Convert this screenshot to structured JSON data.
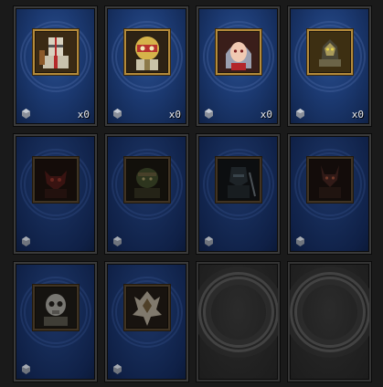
{
  "colors": {
    "background": "#1a1a1a",
    "card_blue": "#1c3a72",
    "frame_gold": "#b38a3a",
    "count_text": "#e8e8e8"
  },
  "cards": [
    {
      "state": "owned",
      "icon": "crusader-portrait-icon",
      "count": "x0"
    },
    {
      "state": "owned",
      "icon": "masked-warrior-portrait-icon",
      "count": "x0"
    },
    {
      "state": "owned",
      "icon": "elf-girl-portrait-icon",
      "count": "x0"
    },
    {
      "state": "owned",
      "icon": "golden-beast-portrait-icon",
      "count": "x0"
    },
    {
      "state": "locked",
      "icon": "red-demon-portrait-icon"
    },
    {
      "state": "locked",
      "icon": "green-ogre-portrait-icon"
    },
    {
      "state": "locked",
      "icon": "dark-knight-portrait-icon"
    },
    {
      "state": "locked",
      "icon": "horned-fiend-portrait-icon"
    },
    {
      "state": "locked",
      "icon": "skull-mage-portrait-icon"
    },
    {
      "state": "locked",
      "icon": "crystal-golem-portrait-icon"
    },
    {
      "state": "empty"
    },
    {
      "state": "empty"
    }
  ]
}
